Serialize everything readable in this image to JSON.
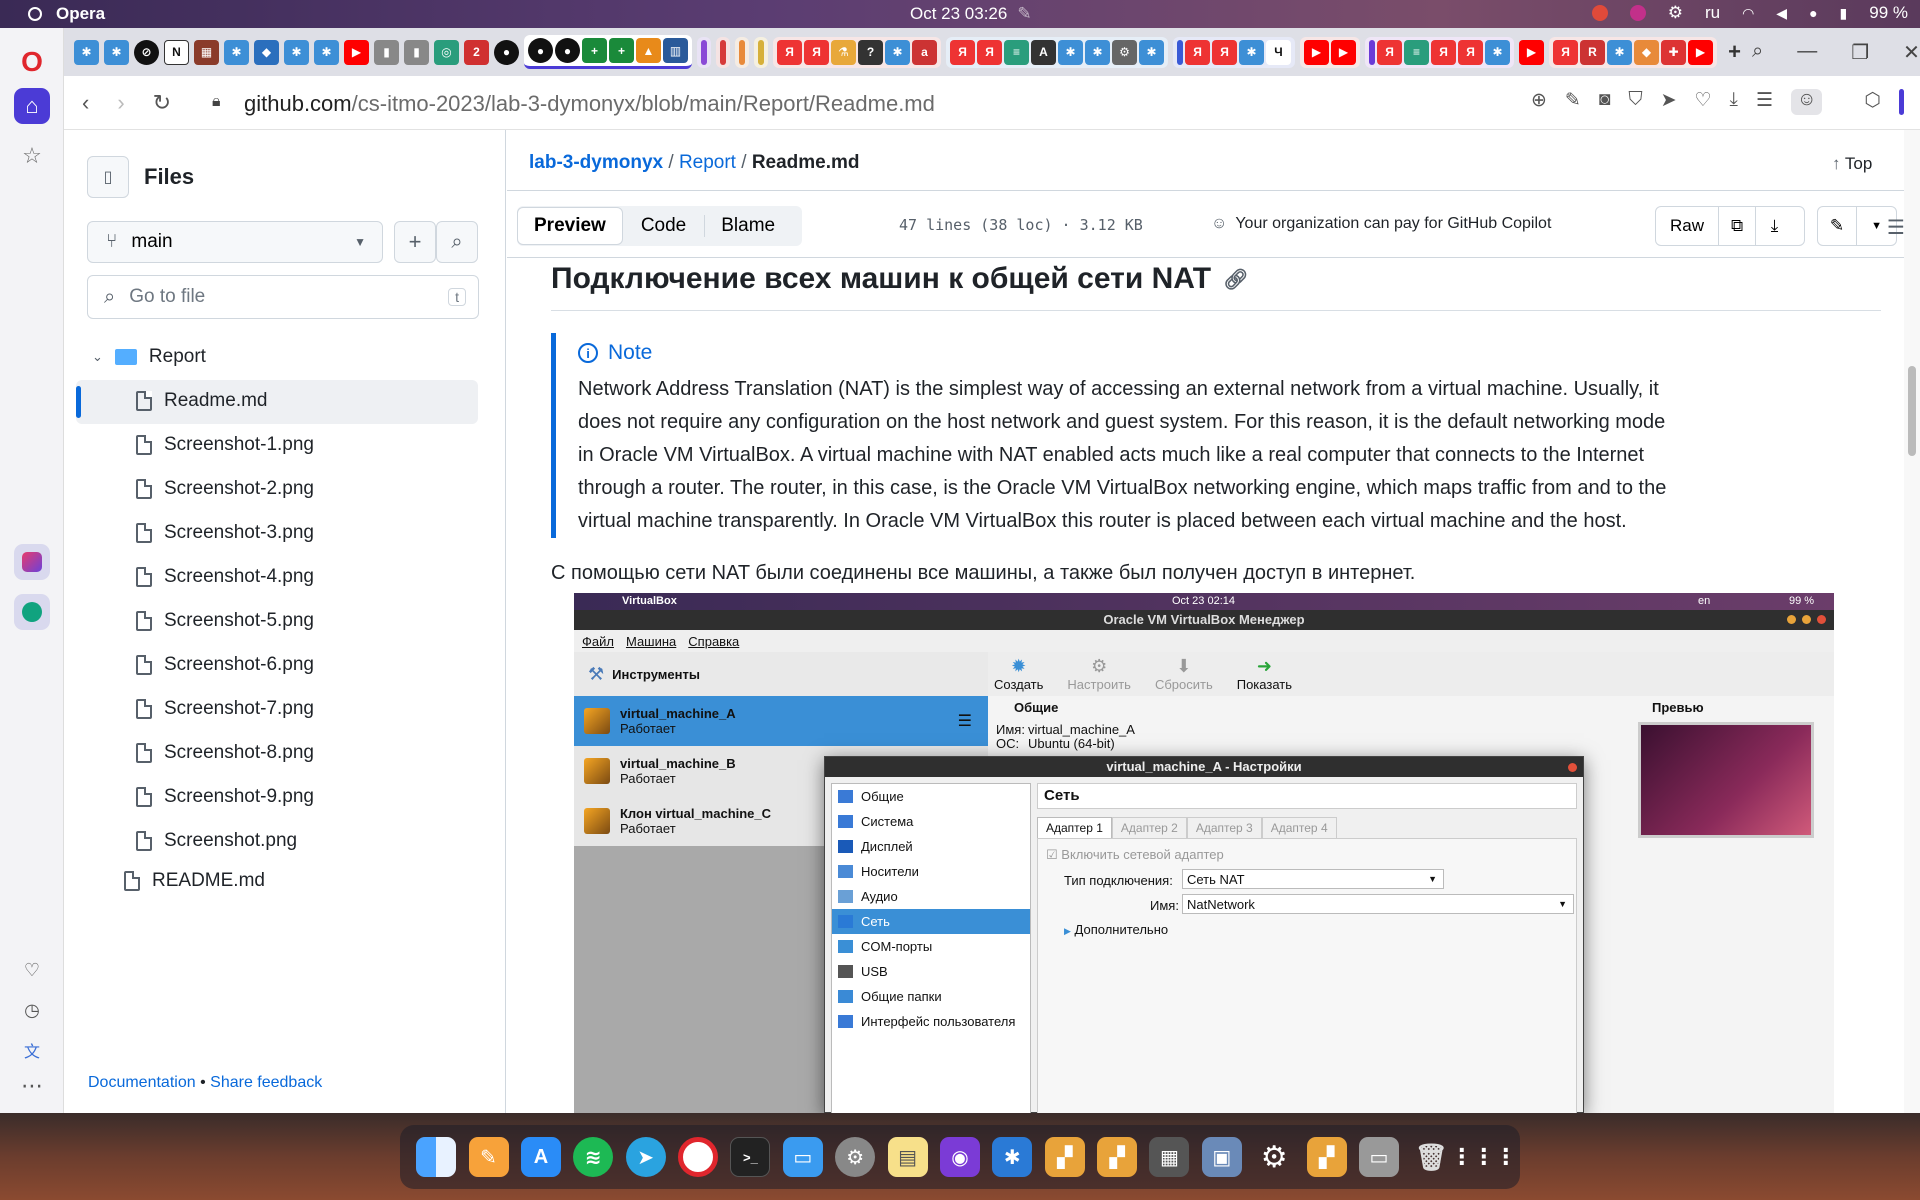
{
  "menubar": {
    "app": "Opera",
    "clock": "Oct 23  03:26",
    "lang": "ru",
    "battery": "99 %"
  },
  "address": {
    "host": "github.com",
    "path": "/cs-itmo-2023/lab-3-dymonyx/blob/main/Report/Readme.md"
  },
  "files": {
    "title": "Files",
    "branch": "main",
    "search_placeholder": "Go to file",
    "search_key": "t",
    "folder": "Report",
    "items": [
      "Readme.md",
      "Screenshot-1.png",
      "Screenshot-2.png",
      "Screenshot-3.png",
      "Screenshot-4.png",
      "Screenshot-5.png",
      "Screenshot-6.png",
      "Screenshot-7.png",
      "Screenshot-8.png",
      "Screenshot-9.png",
      "Screenshot.png"
    ],
    "root_item": "README.md",
    "doc_link": "Documentation",
    "sep": "•",
    "feedback": "Share feedback"
  },
  "breadcrumb": {
    "repo": "lab-3-dymonyx",
    "sep1": "/",
    "folder": "Report",
    "sep2": "/",
    "file": "Readme.md",
    "top": "Top"
  },
  "toolbar": {
    "preview": "Preview",
    "code": "Code",
    "blame": "Blame",
    "meta": "47 lines (38 loc) · 3.12 KB",
    "copilot": "Your organization can pay for GitHub Copilot",
    "raw": "Raw"
  },
  "content": {
    "heading": "Подключение всех машин к общей сети NAT",
    "note_title": "Note",
    "note_lines": [
      "Network Address Translation (NAT) is the simplest way of accessing an external network from a virtual machine. Usually, it",
      "does not require any configuration on the host network and guest system. For this reason, it is the default networking mode",
      "in Oracle VM VirtualBox. A virtual machine with NAT enabled acts much like a real computer that connects to the Internet",
      "through a router. The router, in this case, is the Oracle VM VirtualBox networking engine, which maps traffic from and to the",
      "virtual machine transparently. In Oracle VM VirtualBox this router is placed between each virtual machine and the host."
    ],
    "para": "С помощью сети NAT были соединены все машины, а также был получен доступ в интернет."
  },
  "shot": {
    "app": "VirtualBox",
    "clock": "Oct 23  02:14",
    "lang": "en",
    "battery": "99 %",
    "window_title": "Oracle VM VirtualBox Менеджер",
    "menu": [
      "Файл",
      "Машина",
      "Справка"
    ],
    "tools": "Инструменты",
    "actions": [
      "Создать",
      "Настроить",
      "Сбросить",
      "Показать"
    ],
    "vms": [
      {
        "name": "virtual_machine_A",
        "state": "Работает"
      },
      {
        "name": "virtual_machine_B",
        "state": "Работает"
      },
      {
        "name": "Клон virtual_machine_C",
        "state": "Работает"
      }
    ],
    "general": "Общие",
    "name_label": "Имя:",
    "name_value": "virtual_machine_A",
    "os_label": "ОС:",
    "os_value": "Ubuntu (64-bit)",
    "preview": "Превью",
    "dialog_title": "virtual_machine_A - Настройки",
    "categories": [
      "Общие",
      "Система",
      "Дисплей",
      "Носители",
      "Аудио",
      "Сеть",
      "COM-порты",
      "USB",
      "Общие папки",
      "Интерфейс пользователя"
    ],
    "section": "Сеть",
    "adapters": [
      "Адаптер 1",
      "Адаптер 2",
      "Адаптер 3",
      "Адаптер 4"
    ],
    "enable": "Включить сетевой адаптер",
    "conn_label": "Тип подключения:",
    "conn_value": "Сеть NAT",
    "net_label": "Имя:",
    "net_value": "NatNetwork",
    "advanced": "Дополнительно"
  }
}
